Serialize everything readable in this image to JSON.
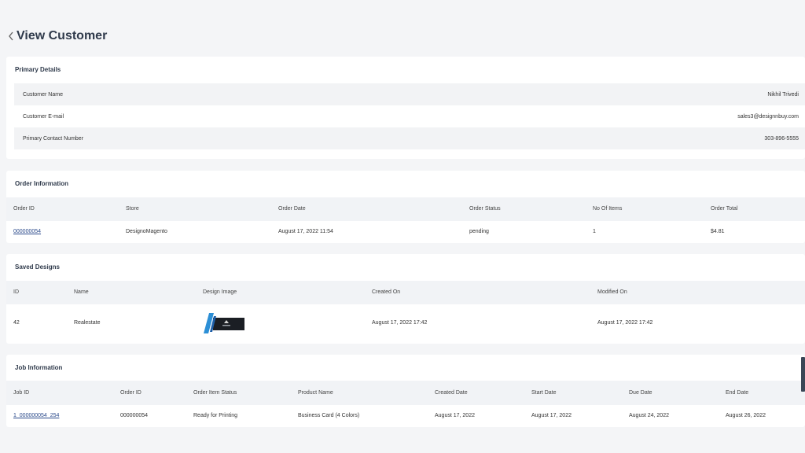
{
  "header": {
    "title": "View Customer"
  },
  "primary": {
    "title": "Primary Details",
    "rows": [
      {
        "label": "Customer Name",
        "value": "Nikhil Trivedi"
      },
      {
        "label": "Customer E-mail",
        "value": "sales3@designnbuy.com"
      },
      {
        "label": "Primary Contact Number",
        "value": "303-896-5555"
      }
    ]
  },
  "orders": {
    "title": "Order Information",
    "columns": [
      "Order ID",
      "Store",
      "Order Date",
      "Order Status",
      "No Of Items",
      "Order Total"
    ],
    "rows": [
      {
        "order_id": "000000054",
        "store": "DesignoMagento",
        "date": "August 17, 2022 11:54",
        "status": "pending",
        "items": "1",
        "total": "$4.81"
      }
    ]
  },
  "designs": {
    "title": "Saved Designs",
    "columns": [
      "ID",
      "Name",
      "Design Image",
      "Created On",
      "Modified On"
    ],
    "rows": [
      {
        "id": "42",
        "name": "Realestate",
        "created": "August 17, 2022 17:42",
        "modified": "August 17, 2022 17:42"
      }
    ]
  },
  "jobs": {
    "title": "Job Information",
    "columns": [
      "Job ID",
      "Order ID",
      "Order Item Status",
      "Product Name",
      "Created Date",
      "Start Date",
      "Due Date",
      "End Date"
    ],
    "rows": [
      {
        "job_id": "1_000000054_254",
        "order_id": "000000054",
        "status": "Ready for Printing",
        "product": "Business Card (4 Colors)",
        "created": "August 17, 2022",
        "start": "August 17, 2022",
        "due": "August 24, 2022",
        "end": "August 26, 2022"
      }
    ]
  },
  "colors": {
    "accent": "#2b4a8b",
    "title": "#2f3a4b",
    "header_bg": "#f1f3f6",
    "page_bg": "#f4f5f7"
  }
}
